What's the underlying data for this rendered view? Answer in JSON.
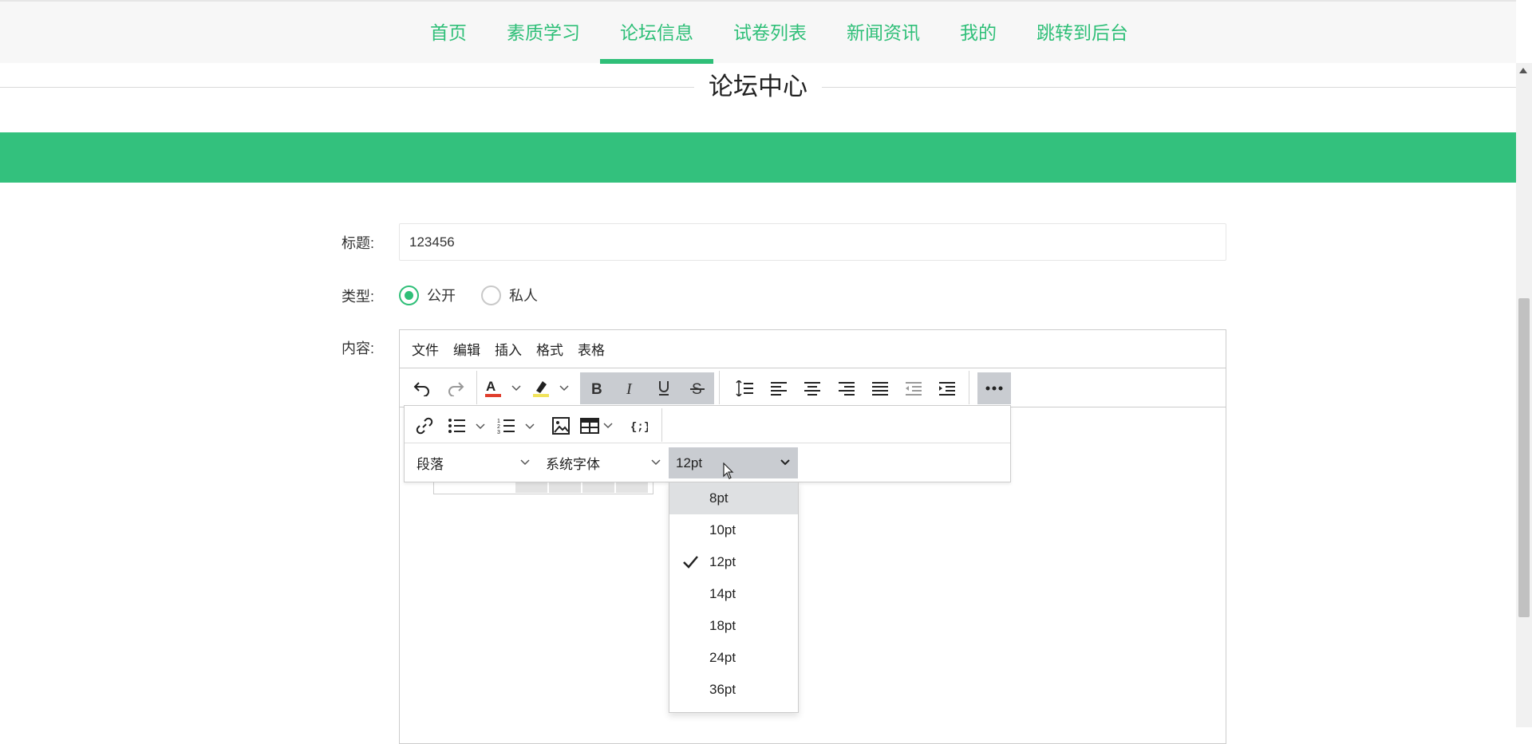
{
  "nav": {
    "items": [
      {
        "label": "首页",
        "active": false
      },
      {
        "label": "素质学习",
        "active": false
      },
      {
        "label": "论坛信息",
        "active": true
      },
      {
        "label": "试卷列表",
        "active": false
      },
      {
        "label": "新闻资讯",
        "active": false
      },
      {
        "label": "我的",
        "active": false
      },
      {
        "label": "跳转到后台",
        "active": false
      }
    ]
  },
  "page": {
    "section_title": "论坛中心"
  },
  "form": {
    "title_label": "标题:",
    "title_value": "123456",
    "type_label": "类型:",
    "type_options": [
      {
        "label": "公开",
        "checked": true
      },
      {
        "label": "私人",
        "checked": false
      }
    ],
    "content_label": "内容:"
  },
  "editor": {
    "menus": [
      "文件",
      "编辑",
      "插入",
      "格式",
      "表格"
    ],
    "toolbar_icons": [
      "undo-icon",
      "redo-icon",
      "text-color-icon",
      "highlight-icon",
      "bold-icon",
      "italic-icon",
      "underline-icon",
      "strikethrough-icon",
      "line-height-icon",
      "align-left-icon",
      "align-center-icon",
      "align-right-icon",
      "align-justify-icon",
      "outdent-icon",
      "indent-icon",
      "more-icon"
    ],
    "overflow_icons": [
      "link-icon",
      "bullet-list-icon",
      "numbered-list-icon",
      "image-icon",
      "table-icon",
      "code-sample-icon"
    ],
    "block_format": "段落",
    "font_family": "系统字体",
    "font_size": "12pt",
    "font_size_options": [
      {
        "label": "8pt",
        "selected": false
      },
      {
        "label": "10pt",
        "selected": false
      },
      {
        "label": "12pt",
        "selected": true
      },
      {
        "label": "14pt",
        "selected": false
      },
      {
        "label": "18pt",
        "selected": false
      },
      {
        "label": "24pt",
        "selected": false
      },
      {
        "label": "36pt",
        "selected": false
      }
    ]
  },
  "colors": {
    "accent": "#2fbf78",
    "banner": "#33c17d",
    "text_color_bar": "#e03e2d",
    "highlight_bar": "#f1e35b"
  }
}
